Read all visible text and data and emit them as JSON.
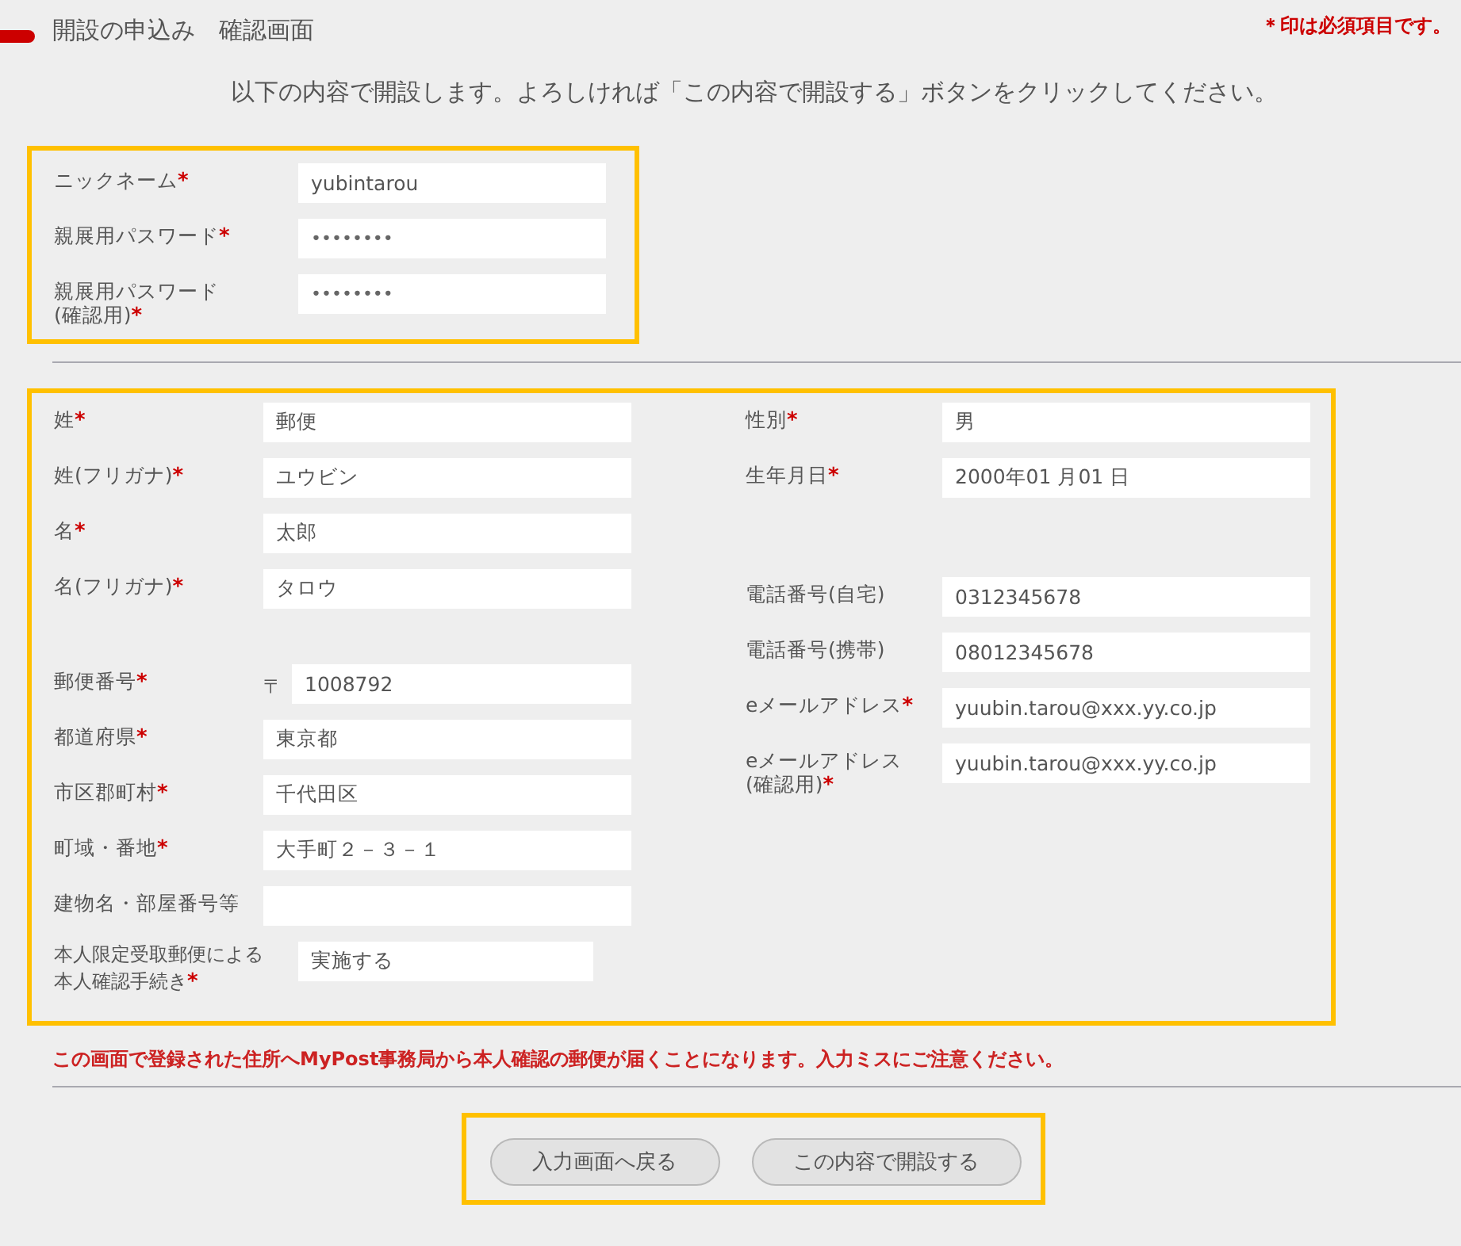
{
  "header": {
    "title": "開設の申込み　確認画面",
    "required_note": "＊印は必須項目です。"
  },
  "intro": "以下の内容で開設します。よろしければ「この内容で開設する」ボタンをクリックしてください。",
  "account": [
    {
      "label": "ニックネーム",
      "mark": "*",
      "value": "yubintarou",
      "kind": "text"
    },
    {
      "label": "親展用パスワード",
      "mark": "*",
      "value": "••••••••",
      "kind": "password"
    },
    {
      "label": "親展用パスワード\n(確認用)",
      "mark": "*",
      "value": "••••••••",
      "kind": "password"
    }
  ],
  "personal": {
    "left": [
      [
        {
          "label": "姓",
          "mark": "*",
          "value": "郵便",
          "kind": "text"
        },
        {
          "label": "姓(フリガナ)",
          "mark": "*",
          "value": "ユウビン",
          "kind": "text"
        },
        {
          "label": "名",
          "mark": "*",
          "value": "太郎",
          "kind": "text"
        },
        {
          "label": "名(フリガナ)",
          "mark": "*",
          "value": "タロウ",
          "kind": "text"
        }
      ],
      [
        {
          "label": "郵便番号",
          "mark": "*",
          "value": "1008792",
          "kind": "postal",
          "prefix": "〒"
        },
        {
          "label": "都道府県",
          "mark": "*",
          "value": "東京都",
          "kind": "text"
        },
        {
          "label": "市区郡町村",
          "mark": "*",
          "value": "千代田区",
          "kind": "text"
        },
        {
          "label": "町域・番地",
          "mark": "*",
          "value": "大手町２－３－１",
          "kind": "text"
        },
        {
          "label": "建物名・部屋番号等",
          "kind": "text"
        },
        {
          "label": "本人限定受取郵便による本人確認手続き",
          "mark": "*",
          "value": "実施する",
          "kind": "choice"
        }
      ]
    ],
    "right": [
      [
        {
          "label": "性別",
          "mark": "*",
          "value": "男",
          "kind": "text"
        },
        {
          "label": "生年月日",
          "mark": "*",
          "value": "2000年01 月01 日",
          "kind": "text"
        }
      ],
      [
        {
          "label": "電話番号(自宅)",
          "value": "0312345678",
          "kind": "text"
        },
        {
          "label": "電話番号(携帯)",
          "value": "08012345678",
          "kind": "text"
        },
        {
          "label": "eメールアドレス",
          "mark": "*",
          "value": "yuubin.tarou@xxx.yy.co.jp",
          "kind": "text"
        },
        {
          "label": "eメールアドレス\n(確認用)",
          "mark": "*",
          "value": "yuubin.tarou@xxx.yy.co.jp",
          "kind": "text"
        }
      ]
    ]
  },
  "notice": "この画面で登録された住所へMyPost事務局から本人確認の郵便が届くことになります。入力ミスにご注意ください。",
  "buttons": [
    "入力画面へ戻る",
    "この内容で開設する"
  ]
}
